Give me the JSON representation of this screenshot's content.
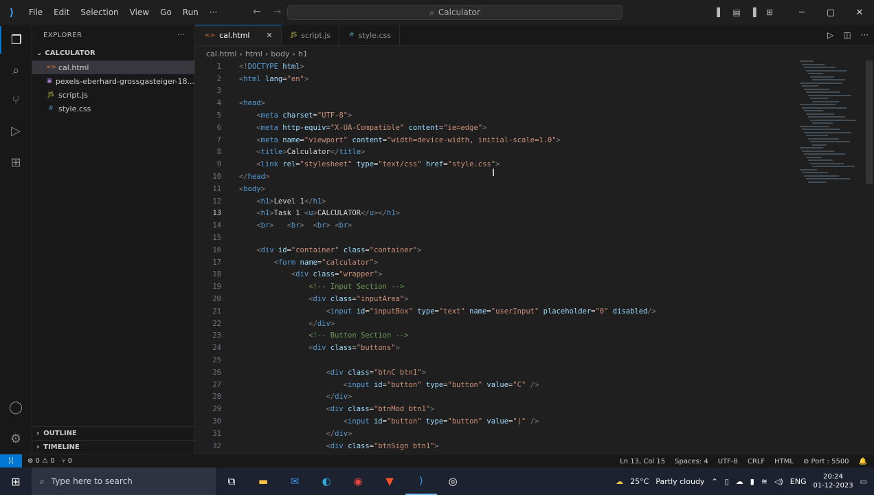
{
  "titlebar": {
    "menu": [
      "File",
      "Edit",
      "Selection",
      "View",
      "Go",
      "Run",
      "···"
    ],
    "search_text": "Calculator",
    "back_arrow": "←",
    "forward_arrow": "→"
  },
  "sidebar": {
    "title": "EXPLORER",
    "more": "···",
    "folder": "CALCULATOR",
    "files": [
      {
        "icon": "<>",
        "name": "cal.html",
        "color": "#e37933"
      },
      {
        "icon": "▣",
        "name": "pexels-eberhard-grossgasteiger-18...",
        "color": "#a074c4"
      },
      {
        "icon": "JS",
        "name": "script.js",
        "color": "#cbcb41"
      },
      {
        "icon": "#",
        "name": "style.css",
        "color": "#519aba"
      }
    ],
    "outline": "OUTLINE",
    "timeline": "TIMELINE"
  },
  "tabs": [
    {
      "icon": "<>",
      "label": "cal.html",
      "active": true,
      "close": "✕"
    },
    {
      "icon": "JS",
      "label": "script.js",
      "active": false
    },
    {
      "icon": "#",
      "label": "style.css",
      "active": false
    }
  ],
  "breadcrumb": [
    "cal.html",
    "html",
    "body",
    "h1"
  ],
  "code_lines": [
    {
      "n": "1",
      "html": "<span class='t-pun'>&lt;!</span><span class='t-tag'>DOCTYPE</span> <span class='t-attr'>html</span><span class='t-pun'>&gt;</span>"
    },
    {
      "n": "2",
      "html": "<span class='t-pun'>&lt;</span><span class='t-tag'>html</span> <span class='t-attr'>lang</span>=<span class='t-str'>\"en\"</span><span class='t-pun'>&gt;</span>"
    },
    {
      "n": "3",
      "html": ""
    },
    {
      "n": "4",
      "html": "<span class='t-pun'>&lt;</span><span class='t-tag'>head</span><span class='t-pun'>&gt;</span>"
    },
    {
      "n": "5",
      "html": "    <span class='t-pun'>&lt;</span><span class='t-tag'>meta</span> <span class='t-attr'>charset</span>=<span class='t-str'>\"UTF-8\"</span><span class='t-pun'>&gt;</span>"
    },
    {
      "n": "6",
      "html": "    <span class='t-pun'>&lt;</span><span class='t-tag'>meta</span> <span class='t-attr'>http-equiv</span>=<span class='t-str'>\"X-UA-Compatible\"</span> <span class='t-attr'>content</span>=<span class='t-str'>\"ie=edge\"</span><span class='t-pun'>&gt;</span>"
    },
    {
      "n": "7",
      "html": "    <span class='t-pun'>&lt;</span><span class='t-tag'>meta</span> <span class='t-attr'>name</span>=<span class='t-str'>\"viewport\"</span> <span class='t-attr'>content</span>=<span class='t-str'>\"width=device-width, initial-scale=1.0\"</span><span class='t-pun'>&gt;</span>"
    },
    {
      "n": "8",
      "html": "    <span class='t-pun'>&lt;</span><span class='t-tag'>title</span><span class='t-pun'>&gt;</span><span class='t-text'>Calculator</span><span class='t-pun'>&lt;/</span><span class='t-tag'>title</span><span class='t-pun'>&gt;</span>"
    },
    {
      "n": "9",
      "html": "    <span class='t-pun'>&lt;</span><span class='t-tag'>link</span> <span class='t-attr'>rel</span>=<span class='t-str'>\"stylesheet\"</span> <span class='t-attr'>type</span>=<span class='t-str'>\"text/css\"</span> <span class='t-attr'>href</span>=<span class='t-str'>\"style.css\"</span><span class='t-pun'>&gt;</span>"
    },
    {
      "n": "10",
      "html": "<span class='t-pun'>&lt;/</span><span class='t-tag'>head</span><span class='t-pun'>&gt;</span>"
    },
    {
      "n": "11",
      "html": "<span class='t-pun'>&lt;</span><span class='t-tag'>body</span><span class='t-pun'>&gt;</span>"
    },
    {
      "n": "12",
      "html": "    <span class='t-pun'>&lt;</span><span class='t-tag'>h1</span><span class='t-pun'>&gt;</span><span class='t-text'>Level 1</span><span class='t-pun'>&lt;/</span><span class='t-tag'>h1</span><span class='t-pun'>&gt;</span>"
    },
    {
      "n": "13",
      "cur": true,
      "html": "    <span class='t-pun'>&lt;</span><span class='t-tag'>h1</span><span class='t-pun'>&gt;</span><span class='t-text'>Task 1</span> <span class='t-pun'>&lt;</span><span class='t-tag'>u</span><span class='t-pun'>&gt;</span><span class='t-text'>CALCULATOR</span><span class='t-pun'>&lt;/</span><span class='t-tag'>u</span><span class='t-pun'>&gt;&lt;/</span><span class='t-tag'>h1</span><span class='t-pun'>&gt;</span>"
    },
    {
      "n": "14",
      "html": "    <span class='t-pun'>&lt;</span><span class='t-tag'>br</span><span class='t-pun'>&gt;</span>   <span class='t-pun'>&lt;</span><span class='t-tag'>br</span><span class='t-pun'>&gt;</span>  <span class='t-pun'>&lt;</span><span class='t-tag'>br</span><span class='t-pun'>&gt;</span> <span class='t-pun'>&lt;</span><span class='t-tag'>br</span><span class='t-pun'>&gt;</span>"
    },
    {
      "n": "15",
      "html": ""
    },
    {
      "n": "16",
      "html": "    <span class='t-pun'>&lt;</span><span class='t-tag'>div</span> <span class='t-attr'>id</span>=<span class='t-str'>\"container\"</span> <span class='t-attr'>class</span>=<span class='t-str'>\"container\"</span><span class='t-pun'>&gt;</span>"
    },
    {
      "n": "17",
      "html": "        <span class='t-pun'>&lt;</span><span class='t-tag'>form</span> <span class='t-attr'>name</span>=<span class='t-str'>\"calculator\"</span><span class='t-pun'>&gt;</span>"
    },
    {
      "n": "18",
      "html": "            <span class='t-pun'>&lt;</span><span class='t-tag'>div</span> <span class='t-attr'>class</span>=<span class='t-str'>\"wrapper\"</span><span class='t-pun'>&gt;</span>"
    },
    {
      "n": "19",
      "html": "                <span class='t-com'>&lt;!-- Input Section --&gt;</span>"
    },
    {
      "n": "20",
      "html": "                <span class='t-pun'>&lt;</span><span class='t-tag'>div</span> <span class='t-attr'>class</span>=<span class='t-str'>\"inputArea\"</span><span class='t-pun'>&gt;</span>"
    },
    {
      "n": "21",
      "html": "                    <span class='t-pun'>&lt;</span><span class='t-tag'>input</span> <span class='t-attr'>id</span>=<span class='t-str'>\"inputBox\"</span> <span class='t-attr'>type</span>=<span class='t-str'>\"text\"</span> <span class='t-attr'>name</span>=<span class='t-str'>\"userInput\"</span> <span class='t-attr'>placeholder</span>=<span class='t-str'>\"0\"</span> <span class='t-attr'>disabled</span><span class='t-pun'>/&gt;</span>"
    },
    {
      "n": "22",
      "html": "                <span class='t-pun'>&lt;/</span><span class='t-tag'>div</span><span class='t-pun'>&gt;</span>"
    },
    {
      "n": "23",
      "html": "                <span class='t-com'>&lt;!-- Button Section --&gt;</span>"
    },
    {
      "n": "24",
      "html": "                <span class='t-pun'>&lt;</span><span class='t-tag'>div</span> <span class='t-attr'>class</span>=<span class='t-str'>\"buttons\"</span><span class='t-pun'>&gt;</span>"
    },
    {
      "n": "25",
      "html": ""
    },
    {
      "n": "26",
      "html": "                    <span class='t-pun'>&lt;</span><span class='t-tag'>div</span> <span class='t-attr'>class</span>=<span class='t-str'>\"btnC btn1\"</span><span class='t-pun'>&gt;</span>"
    },
    {
      "n": "27",
      "html": "                        <span class='t-pun'>&lt;</span><span class='t-tag'>input</span> <span class='t-attr'>id</span>=<span class='t-str'>\"button\"</span> <span class='t-attr'>type</span>=<span class='t-str'>\"button\"</span> <span class='t-attr'>value</span>=<span class='t-str'>\"C\"</span> <span class='t-pun'>/&gt;</span>"
    },
    {
      "n": "28",
      "html": "                    <span class='t-pun'>&lt;/</span><span class='t-tag'>div</span><span class='t-pun'>&gt;</span>"
    },
    {
      "n": "29",
      "html": "                    <span class='t-pun'>&lt;</span><span class='t-tag'>div</span> <span class='t-attr'>class</span>=<span class='t-str'>\"btnMod btn1\"</span><span class='t-pun'>&gt;</span>"
    },
    {
      "n": "30",
      "html": "                        <span class='t-pun'>&lt;</span><span class='t-tag'>input</span> <span class='t-attr'>id</span>=<span class='t-str'>\"button\"</span> <span class='t-attr'>type</span>=<span class='t-str'>\"button\"</span> <span class='t-attr'>value</span>=<span class='t-str'>\"(\"</span> <span class='t-pun'>/&gt;</span>"
    },
    {
      "n": "31",
      "html": "                    <span class='t-pun'>&lt;/</span><span class='t-tag'>div</span><span class='t-pun'>&gt;</span>"
    },
    {
      "n": "32",
      "html": "                    <span class='t-pun'>&lt;</span><span class='t-tag'>div</span> <span class='t-attr'>class</span>=<span class='t-str'>\"btnSign btn1\"</span><span class='t-pun'>&gt;</span>"
    }
  ],
  "statusbar": {
    "remote": "⟩⟨",
    "errors": "⊗ 0 ⚠ 0",
    "ports": "⑂ 0",
    "position": "Ln 13, Col 15",
    "spaces": "Spaces: 4",
    "encoding": "UTF-8",
    "eol": "CRLF",
    "language": "HTML",
    "port": "⊘ Port : 5500",
    "bell": "🔔"
  },
  "taskbar": {
    "search_placeholder": "Type here to search",
    "weather_temp": "25°C",
    "weather_text": "Partly cloudy",
    "lang": "ENG",
    "time": "20:24",
    "date": "01-12-2023"
  }
}
